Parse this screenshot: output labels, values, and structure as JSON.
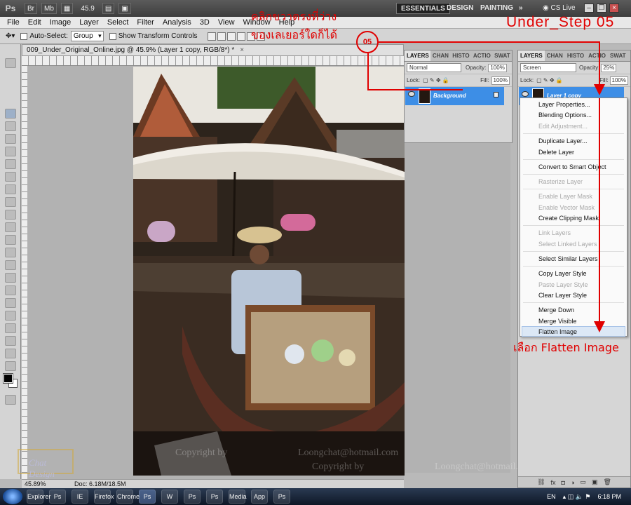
{
  "app_bar": {
    "logo": "Ps",
    "bridge_btn": "Br",
    "minibridge_btn": "Mb",
    "zoom_value": "45.9",
    "workspaces": [
      "ESSENTIALS",
      "DESIGN",
      "PAINTING"
    ],
    "more": "»",
    "cs_live": "CS Live"
  },
  "menus": [
    "File",
    "Edit",
    "Image",
    "Layer",
    "Select",
    "Filter",
    "Analysis",
    "3D",
    "View",
    "Window",
    "Help"
  ],
  "options_bar": {
    "auto_select_label": "Auto-Select:",
    "auto_select_value": "Group",
    "transform_label": "Show Transform Controls"
  },
  "document": {
    "tab_title": "009_Under_Original_Online.jpg @ 45.9% (Layer 1 copy, RGB/8*) *",
    "close": "×",
    "status_zoom": "45.89%",
    "status_doc": "Doc: 6.18M/18.5M"
  },
  "watermark": {
    "copyright_line1": "Copyright by",
    "email1": "Loongchat@hotmail.com",
    "copyright_line2": "Copyright by",
    "email2": "Loongchat@hotmail.com",
    "logo_text": "Chat Design",
    "copyright_symbol": "©"
  },
  "left_panel": {
    "tabs": [
      "LAYERS",
      "CHAN",
      "HISTO",
      "ACTIO",
      "SWAT"
    ],
    "blend_mode": "Normal",
    "opacity_label": "Opacity:",
    "opacity_value": "100%",
    "lock_label": "Lock:",
    "fill_label": "Fill:",
    "fill_value": "100%",
    "layer_name": "Background"
  },
  "right_panel": {
    "tabs": [
      "LAYERS",
      "CHAN",
      "HISTO",
      "ACTIO",
      "SWAT"
    ],
    "blend_mode": "Screen",
    "opacity_label": "Opacity:",
    "opacity_value": "25%",
    "lock_label": "Lock:",
    "fill_label": "Fill:",
    "fill_value": "100%",
    "layer_name": "Layer 1 copy"
  },
  "context_menu": {
    "items": [
      {
        "label": "Layer Properties...",
        "enabled": true
      },
      {
        "label": "Blending Options...",
        "enabled": true
      },
      {
        "label": "Edit Adjustment...",
        "enabled": false
      },
      {
        "label": "Duplicate Layer...",
        "enabled": true
      },
      {
        "label": "Delete Layer",
        "enabled": true
      },
      {
        "label": "Convert to Smart Object",
        "enabled": true
      },
      {
        "label": "Rasterize Layer",
        "enabled": false
      },
      {
        "label": "Enable Layer Mask",
        "enabled": false
      },
      {
        "label": "Enable Vector Mask",
        "enabled": false
      },
      {
        "label": "Create Clipping Mask",
        "enabled": true
      },
      {
        "label": "Link Layers",
        "enabled": false
      },
      {
        "label": "Select Linked Layers",
        "enabled": false
      },
      {
        "label": "Select Similar Layers",
        "enabled": true
      },
      {
        "label": "Copy Layer Style",
        "enabled": true
      },
      {
        "label": "Paste Layer Style",
        "enabled": false
      },
      {
        "label": "Clear Layer Style",
        "enabled": true
      },
      {
        "label": "Merge Down",
        "enabled": true
      },
      {
        "label": "Merge Visible",
        "enabled": true
      },
      {
        "label": "Flatten Image",
        "enabled": true,
        "highlighted": true
      }
    ]
  },
  "annotations": {
    "title": "Under_Step 05",
    "thai_line1": "คลิกขวาตรงที่ว่าง",
    "thai_line2": "ของเลเยอร์ใดก็ได้",
    "marker": "05",
    "bottom": "เลือก Flatten Image",
    "color": "#e00000"
  },
  "taskbar": {
    "apps": [
      "Explorer",
      "Ps",
      "IE",
      "Firefox",
      "Chrome",
      "Ps",
      "W",
      "Ps",
      "Ps",
      "Media",
      "App",
      "Ps"
    ],
    "active_index": 5,
    "lang": "EN",
    "time": "6:18 PM"
  }
}
